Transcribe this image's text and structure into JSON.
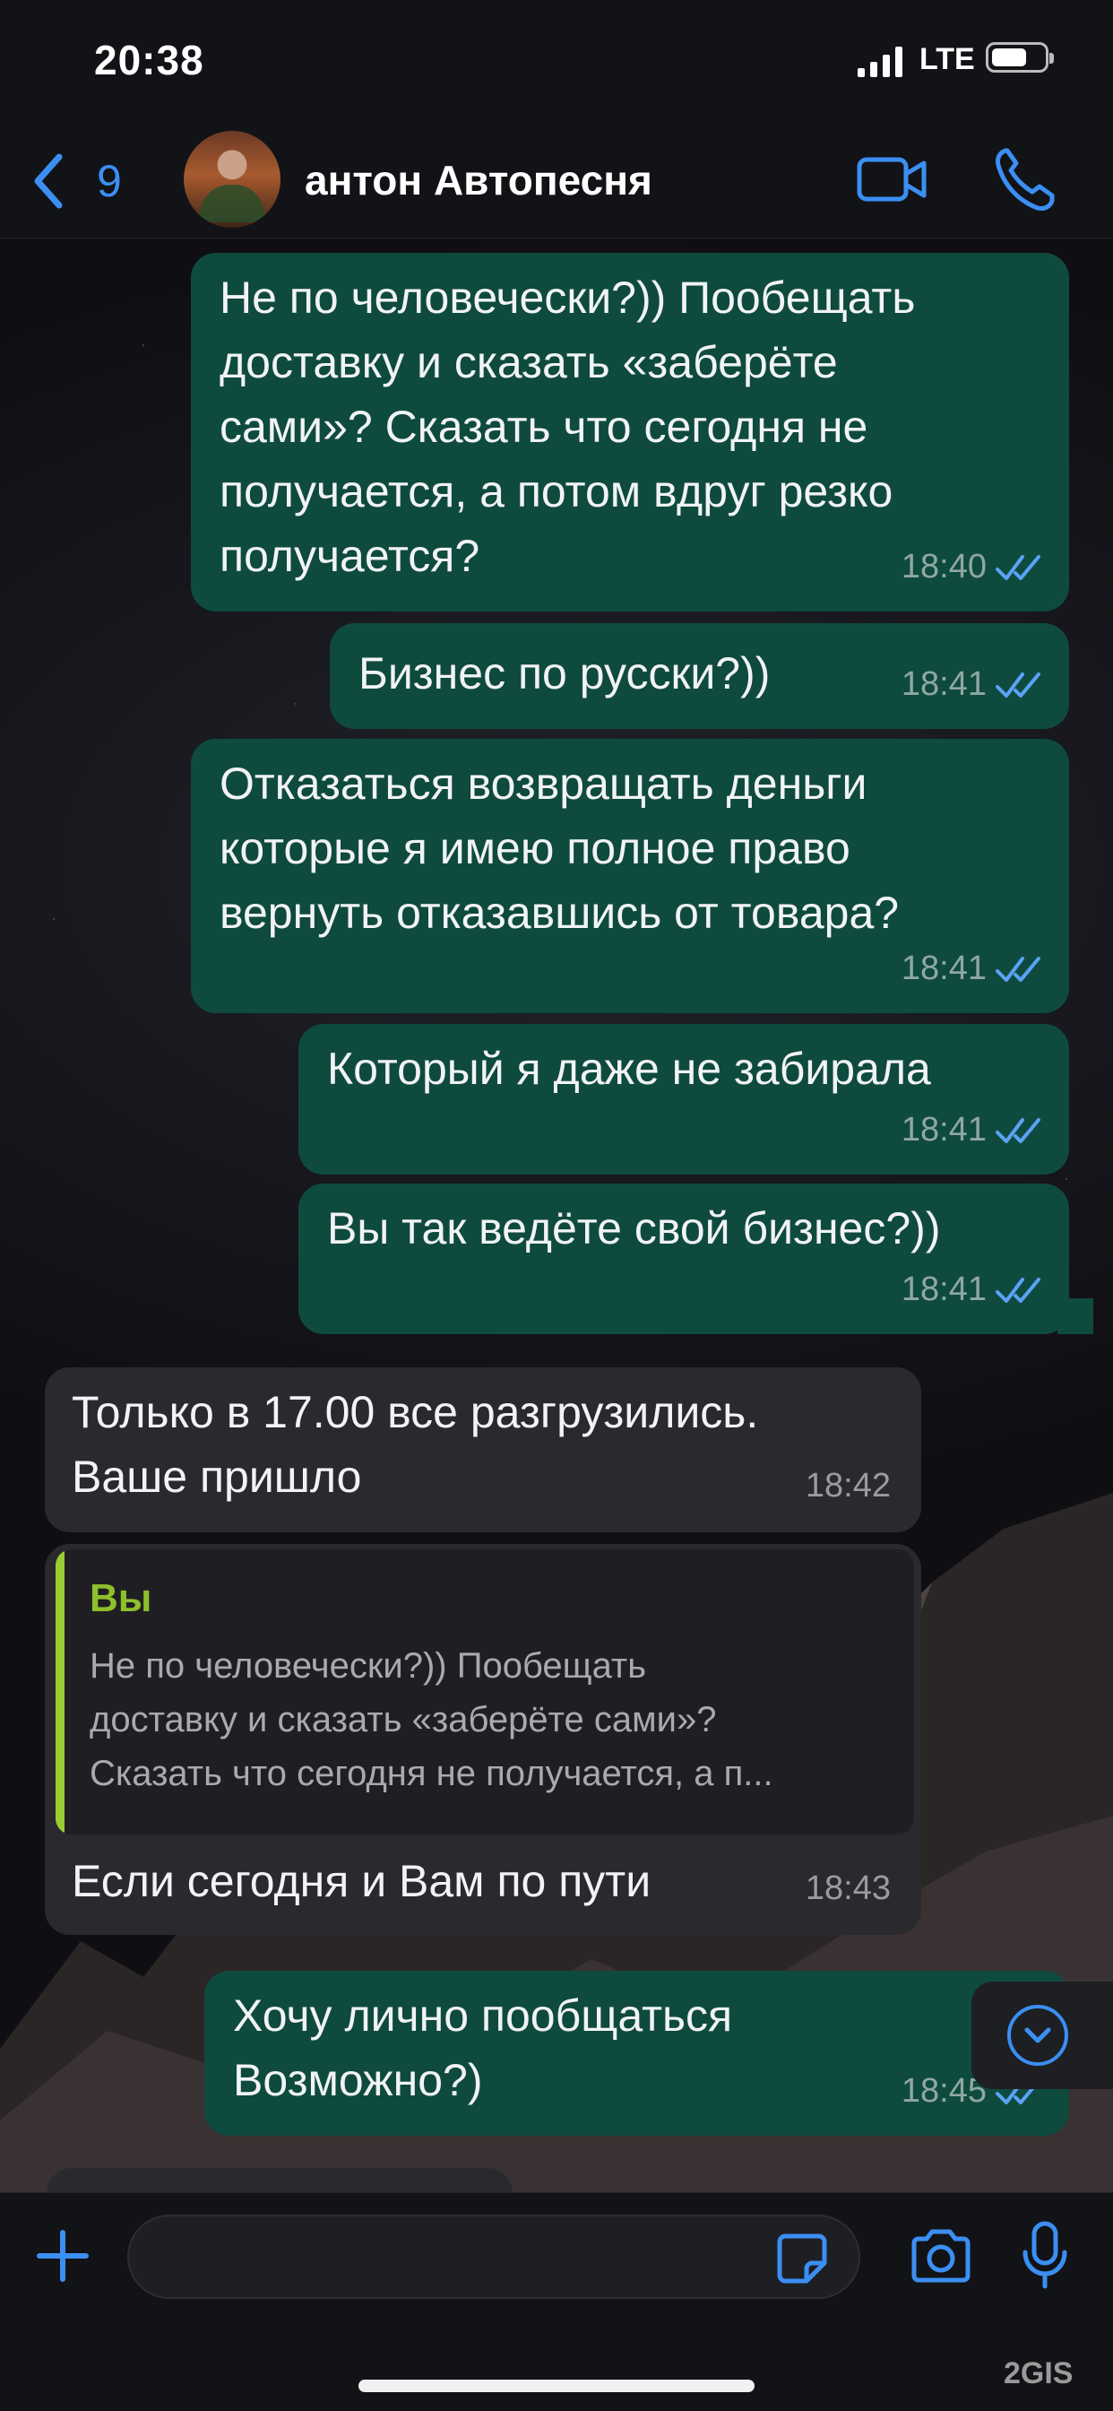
{
  "status": {
    "time": "20:38",
    "network": "LTE"
  },
  "header": {
    "back_count": "9",
    "contact_name": "антон Автопесня"
  },
  "messages": [
    {
      "text": "Не по человечески?)) Пообещать\nдоставку и сказать «заберёте\nсами»? Сказать что сегодня не\nполучается, а потом вдруг резко\nполучается?",
      "time": "18:40"
    },
    {
      "text": "Бизнес по русски?))",
      "time": "18:41"
    },
    {
      "text": "Отказаться возвращать деньги\nкоторые я имею полное право\nвернуть отказавшись от товара?",
      "time": "18:41"
    },
    {
      "text": "Который я даже не забирала",
      "time": "18:41"
    },
    {
      "text": "Вы так ведёте свой бизнес?))",
      "time": "18:41"
    },
    {
      "text": "Только в 17.00 все разгрузились.\nВаше пришло",
      "time": "18:42"
    },
    {
      "quote_author": "Вы",
      "quote_text": "Не по человечески?)) Пообещать\nдоставку и сказать «заберёте сами»?\nСказать что сегодня не получается, а п...",
      "text": "Если сегодня и Вам по пути",
      "time": "18:43"
    },
    {
      "text": "Хочу лично пообщаться\nВозможно?)",
      "time": "18:45"
    }
  ],
  "watermark": "2GIS",
  "colors": {
    "accent": "#3b8ff3",
    "outgoing": "#0f4a3f",
    "incoming": "#2a2a2e",
    "quote_bar": "#9acd32"
  },
  "icons": [
    "back-chevron-icon",
    "video-call-icon",
    "phone-icon",
    "read-ticks-icon",
    "chevron-down-icon",
    "plus-icon",
    "sticker-icon",
    "camera-icon",
    "microphone-icon"
  ]
}
